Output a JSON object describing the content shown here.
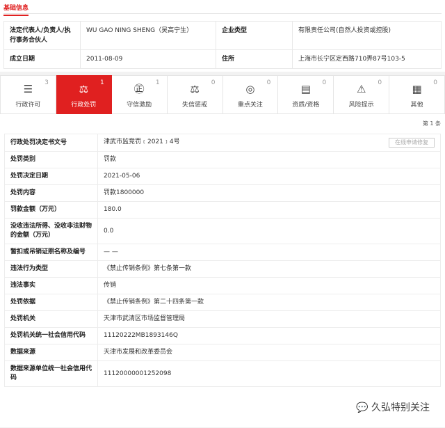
{
  "section_title": "基础信息",
  "basic": [
    {
      "label1": "法定代表人/负责人/执行事务合伙人",
      "value1": "WU GAO NING SHENG（吴高宁生）",
      "label2": "企业类型",
      "value2": "有限责任公司(自然人投资或控股)"
    },
    {
      "label1": "成立日期",
      "value1": "2011-08-09",
      "label2": "住所",
      "value2": "上海市长宁区定西路710弄87号103-5"
    }
  ],
  "tabs": [
    {
      "label": "行政许可",
      "count": "3",
      "icon": "☰"
    },
    {
      "label": "行政处罚",
      "count": "1",
      "icon": "⚖"
    },
    {
      "label": "守信激励",
      "count": "1",
      "icon": "㊣"
    },
    {
      "label": "失信惩戒",
      "count": "0",
      "icon": "⚖"
    },
    {
      "label": "重点关注",
      "count": "0",
      "icon": "◎"
    },
    {
      "label": "资质/资格",
      "count": "0",
      "icon": "▤"
    },
    {
      "label": "风险提示",
      "count": "0",
      "icon": "⚠"
    },
    {
      "label": "其他",
      "count": "0",
      "icon": "▦"
    }
  ],
  "page_indicator": "第 1 条",
  "repair_button": "在线申请修复",
  "rows": [
    {
      "label": "行政处罚决定书文号",
      "value": "津武市监竞罚﹝2021﹞4号"
    },
    {
      "label": "处罚类别",
      "value": "罚款"
    },
    {
      "label": "处罚决定日期",
      "value": "2021-05-06"
    },
    {
      "label": "处罚内容",
      "value": "罚款1800000"
    },
    {
      "label": "罚款金额（万元）",
      "value": "180.0"
    },
    {
      "label": "没收违法所得、没收非法财物的金额（万元）",
      "value": "0.0"
    },
    {
      "label": "暂扣或吊销证照名称及编号",
      "value": "— —"
    },
    {
      "label": "违法行为类型",
      "value": "《禁止传销条例》第七条第一款"
    },
    {
      "label": "违法事实",
      "value": "传销"
    },
    {
      "label": "处罚依据",
      "value": "《禁止传销条例》第二十四条第一款"
    },
    {
      "label": "处罚机关",
      "value": "天津市武清区市场监督管理局"
    },
    {
      "label": "处罚机关统一社会信用代码",
      "value": "11120222MB1893146Q"
    },
    {
      "label": "数据来源",
      "value": "天津市发展和改革委员会"
    },
    {
      "label": "数据来源单位统一社会信用代码",
      "value": "11120000001252098"
    }
  ],
  "watermark": "久弘特别关注"
}
